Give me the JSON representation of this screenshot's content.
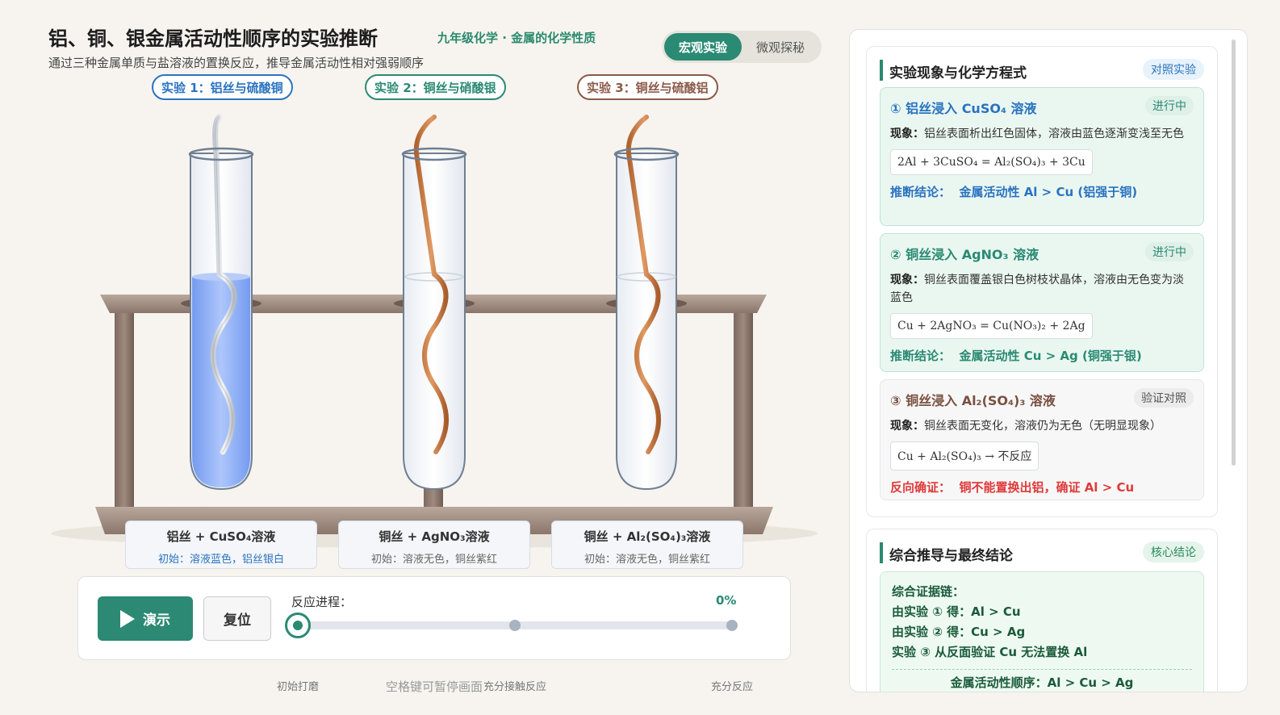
{
  "header": {
    "title": "铝、铜、银金属活动性顺序的实验推断",
    "tag": "九年级化学 · 金属的化学性质",
    "subtitle": "通过三种金属单质与盐溶液的置换反应，推导金属活动性相对强弱顺序",
    "modes": [
      "宏观实验",
      "微观探秘"
    ],
    "active_mode": "宏观实验"
  },
  "experiments": [
    {
      "label": "实验 1：铝丝与硫酸铜",
      "card_main": "铝丝 + CuSO₄溶液",
      "card_init": "初始：溶液蓝色，铝丝银白",
      "color": "#2a73c0"
    },
    {
      "label": "实验 2：铜丝与硝酸银",
      "card_main": "铜丝 + AgNO₃溶液",
      "card_init": "初始：溶液无色，铜丝紫红",
      "color": "#2a8a73"
    },
    {
      "label": "实验 3：铜丝与硫酸铝",
      "card_main": "铜丝 + Al₂(SO₄)₃溶液",
      "card_init": "初始：溶液无色，铜丝紫红",
      "color": "#8a5a48"
    }
  ],
  "controls": {
    "play_label": "演示",
    "reset_label": "复位",
    "progress_label": "反应进程：",
    "progress_value": "0%",
    "progress": 0,
    "stops": [
      "初始打磨",
      "充分接触反应",
      "充分反应"
    ]
  },
  "hint": "空格键可暂停画面",
  "panel": {
    "section1": {
      "title": "实验现象与化学方程式",
      "badge": "对照实验",
      "cards": [
        {
          "title": "① 铝丝浸入 CuSO₄ 溶液",
          "status": "进行中",
          "phen_label": "现象：",
          "phen": "铝丝表面析出红色固体，溶液由蓝色逐渐变浅至无色",
          "eq": "2Al + 3CuSO₄ = Al₂(SO₄)₃ + 3Cu",
          "conc_label": "推断结论：",
          "conc": "金属活动性 Al > Cu (铝强于铜)"
        },
        {
          "title": "② 铜丝浸入 AgNO₃ 溶液",
          "status": "进行中",
          "phen_label": "现象：",
          "phen": "铜丝表面覆盖银白色树枝状晶体，溶液由无色变为淡蓝色",
          "eq": "Cu + 2AgNO₃ = Cu(NO₃)₂ + 2Ag",
          "conc_label": "推断结论：",
          "conc": "金属活动性 Cu > Ag (铜强于银)"
        },
        {
          "title": "③ 铜丝浸入 Al₂(SO₄)₃ 溶液",
          "status": "验证对照",
          "phen_label": "现象：",
          "phen": "铜丝表面无变化，溶液仍为无色（无明显现象）",
          "eq": "Cu + Al₂(SO₄)₃ → 不反应",
          "conc_label": "反向确证：",
          "conc": "铜不能置换出铝，确证 Al > Cu"
        }
      ]
    },
    "section2": {
      "title": "综合推导与最终结论",
      "badge": "核心结论",
      "lines": [
        "综合证据链：",
        "由实验 ① 得：Al > Cu",
        "由实验 ② 得：Cu > Ag",
        "实验 ③ 从反面验证 Cu 无法置换 Al"
      ],
      "final": "金属活动性顺序：Al > Cu > Ag"
    }
  },
  "colors": {
    "accent": "#2a8a73",
    "blue": "#2a73c0",
    "red": "#e03a3a",
    "copper": "#c87a45",
    "solution_blue": "#7ea7f5"
  }
}
